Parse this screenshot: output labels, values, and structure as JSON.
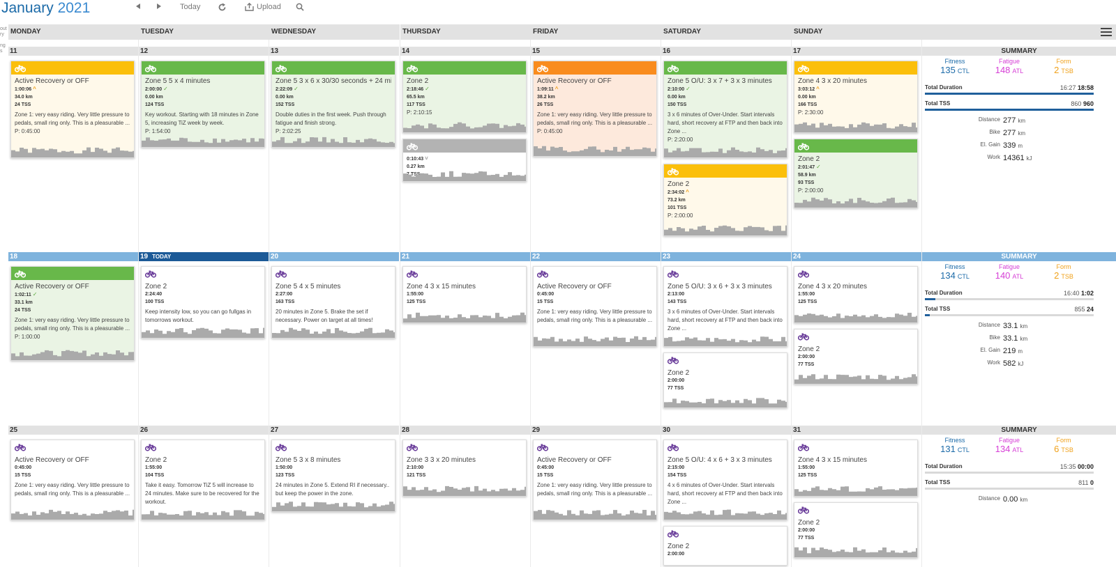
{
  "header": {
    "month": "January",
    "year": "2021",
    "today_label": "Today",
    "upload_label": "Upload",
    "left_sliver": "out\nry\n\nng\ns"
  },
  "day_names": [
    "MONDAY",
    "TUESDAY",
    "WEDNESDAY",
    "THURSDAY",
    "FRIDAY",
    "SATURDAY",
    "SUNDAY"
  ],
  "colors": {
    "title_blue": "#1b6aa8",
    "today_blue": "#1c5a97",
    "week_blue": "#7eb3dd",
    "yellow": "#fbbf0b",
    "green": "#68b84a",
    "orange": "#f98c1e",
    "fitness": "#1b6aa8",
    "fatigue": "#d63fd6",
    "form": "#f0a11a"
  },
  "weeks": [
    {
      "days": [
        "11",
        "12",
        "13",
        "14",
        "15",
        "16",
        "17"
      ],
      "today_index": -1,
      "today_label": "",
      "bar_style": "grey",
      "workouts": [
        [
          {
            "bar": "yellow",
            "bg": "c-yellow",
            "icon": "bike-icon",
            "title": "Active Recovery or OFF",
            "stats": [
              "1:00:06",
              "34.0 km",
              "24 TSS"
            ],
            "check": "o",
            "desc": "Zone 1: very easy riding. Very little pressure to pedals, small ring only. This is a pleasurable ...",
            "plan": "P: 0:45:00",
            "h": 140
          }
        ],
        [
          {
            "bar": "green",
            "bg": "c-green",
            "icon": "bike-icon",
            "title": "Zone 5 5 x 4 minutes",
            "stats": [
              "2:00:00",
              "0.00 km",
              "124 TSS"
            ],
            "check": "g",
            "desc": "Key workout. Starting with 18 minutes in Zone 5, increasing TiZ week by week.",
            "plan": "P: 1:54:00",
            "h": 125
          }
        ],
        [
          {
            "bar": "green",
            "bg": "c-green",
            "icon": "bike-icon",
            "title": "Zone 5 3 x 6 x 30/30 seconds + 24 mi...",
            "stats": [
              "2:22:09",
              "0.00 km",
              "152 TSS"
            ],
            "check": "g",
            "desc": "Double duties in the first week. Push through fatigue and finish strong.",
            "plan": "P: 2:02:25",
            "h": 125
          }
        ],
        [
          {
            "bar": "green",
            "bg": "c-green",
            "icon": "bike-icon",
            "title": "Zone 2",
            "stats": [
              "2:18:46",
              "65.5 km",
              "117 TSS"
            ],
            "check": "g",
            "desc": "",
            "plan": "P: 2:10:15",
            "h": 104
          },
          {
            "bar": "grey",
            "bg": "",
            "icon": "bike-icon",
            "title": "",
            "stats": [
              "0:10:43",
              "0.27 km",
              "7 TSS"
            ],
            "check": "gr",
            "desc": "",
            "plan": "",
            "h": 62
          }
        ],
        [
          {
            "bar": "orange",
            "bg": "c-orange",
            "icon": "bike-icon",
            "title": "Active Recovery or OFF",
            "stats": [
              "1:09:11",
              "38.2 km",
              "26 TSS"
            ],
            "check": "o",
            "desc": "Zone 1: very easy riding. Very little pressure to pedals, small ring only. This is a pleasurable ...",
            "plan": "P: 0:45:00",
            "h": 138
          }
        ],
        [
          {
            "bar": "green",
            "bg": "c-green",
            "icon": "bike-icon",
            "title": "Zone 5 O/U: 3 x 7 + 3 x 3 minutes",
            "stats": [
              "2:10:00",
              "0.00 km",
              "150 TSS"
            ],
            "check": "g",
            "desc": "3 x 6 minutes of Over-Under. Start intervals hard, short recovery at FTP and then back into Zone ...",
            "plan": "P: 2:20:00",
            "h": 140
          },
          {
            "bar": "yellow",
            "bg": "c-yellow",
            "icon": "bike-icon",
            "title": "Zone 2",
            "stats": [
              "2:34:02",
              "73.2 km",
              "101 TSS"
            ],
            "check": "o",
            "desc": "",
            "plan": "P: 2:00:00",
            "h": 104
          }
        ],
        [
          {
            "bar": "yellow",
            "bg": "c-yellow",
            "icon": "bike-icon",
            "title": "Zone 4 3 x 20 minutes",
            "stats": [
              "3:03:12",
              "0.00 km",
              "166 TSS"
            ],
            "check": "o",
            "desc": "",
            "plan": "P: 2:30:00",
            "h": 104
          },
          {
            "bar": "green",
            "bg": "c-green",
            "icon": "bike-icon",
            "title": "Zone 2",
            "stats": [
              "2:01:47",
              "58.9 km",
              "93 TSS"
            ],
            "check": "g",
            "desc": "",
            "plan": "P: 2:00:00",
            "h": 100
          }
        ]
      ],
      "summary": {
        "label": "SUMMARY",
        "fitness_label": "Fitness",
        "fitness": "135",
        "fitness_unit": "CTL",
        "fatigue_label": "Fatigue",
        "fatigue": "148",
        "fatigue_unit": "ATL",
        "form_label": "Form",
        "form": "2",
        "form_unit": "TSB",
        "duration_label": "Total Duration",
        "duration_planned": "16:27",
        "duration_done": "18:58",
        "duration_fill": 1.0,
        "tss_label": "Total TSS",
        "tss_planned": "860",
        "tss_done": "960",
        "tss_fill": 1.0,
        "stats": [
          {
            "k": "Distance",
            "v": "277",
            "u": "km"
          },
          {
            "k": "Bike",
            "v": "277",
            "u": "km"
          },
          {
            "k": "El. Gain",
            "v": "339",
            "u": "m"
          },
          {
            "k": "Work",
            "v": "14361",
            "u": "kJ"
          }
        ]
      }
    },
    {
      "days": [
        "18",
        "19",
        "20",
        "21",
        "22",
        "23",
        "24"
      ],
      "today_index": 1,
      "today_label": "TODAY",
      "bar_style": "blue",
      "workouts": [
        [
          {
            "bar": "green",
            "bg": "c-green",
            "icon": "bike-icon",
            "title": "Active Recovery or OFF",
            "stats": [
              "1:02:11",
              "33.1 km",
              "24 TSS"
            ],
            "check": "g",
            "desc": "Zone 1: very easy riding. Very little pressure to pedals, small ring only. This is a pleasurable ...",
            "plan": "P: 1:00:00",
            "h": 136
          }
        ],
        [
          {
            "bar": "none",
            "bg": "",
            "icon": "bike-purple-icon",
            "title": "Zone 2",
            "stats": [
              "2:24:40",
              "100 TSS"
            ],
            "check": "",
            "desc": "Keep intensity low, so you can go fullgas in tomorrows workout.",
            "plan": "",
            "h": 104
          }
        ],
        [
          {
            "bar": "none",
            "bg": "",
            "icon": "bike-purple-icon",
            "title": "Zone 5 4 x 5 minutes",
            "stats": [
              "2:27:00",
              "163 TSS"
            ],
            "check": "",
            "desc": "20 minutes in Zone 5. Brake the set if necessary. Power on target at all times!",
            "plan": "",
            "h": 104
          }
        ],
        [
          {
            "bar": "none",
            "bg": "",
            "icon": "bike-purple-icon",
            "title": "Zone 4 3 x 15 minutes",
            "stats": [
              "1:55:00",
              "125 TSS"
            ],
            "check": "",
            "desc": "",
            "plan": "",
            "h": 82
          }
        ],
        [
          {
            "bar": "none",
            "bg": "",
            "icon": "bike-purple-icon",
            "title": "Active Recovery or OFF",
            "stats": [
              "0:45:00",
              "15 TSS"
            ],
            "check": "",
            "desc": "Zone 1: very easy riding. Very little pressure to pedals, small ring only. This is a pleasurable ...",
            "plan": "",
            "h": 116
          }
        ],
        [
          {
            "bar": "none",
            "bg": "",
            "icon": "bike-purple-icon",
            "title": "Zone 5 O/U: 3 x 6 + 3 x 3 minutes",
            "stats": [
              "2:13:00",
              "143 TSS"
            ],
            "check": "",
            "desc": "3 x 6 minutes of Over-Under. Start intervals hard, short recovery at FTP and then back into Zone ...",
            "plan": "",
            "h": 116
          },
          {
            "bar": "none",
            "bg": "",
            "icon": "bike-purple-icon",
            "title": "Zone 2",
            "stats": [
              "2:00:00",
              "77 TSS"
            ],
            "check": "",
            "desc": "",
            "plan": "",
            "h": 80
          }
        ],
        [
          {
            "bar": "none",
            "bg": "",
            "icon": "bike-purple-icon",
            "title": "Zone 4 3 x 20 minutes",
            "stats": [
              "1:55:00",
              "125 TSS"
            ],
            "check": "",
            "desc": "",
            "plan": "",
            "h": 82
          },
          {
            "bar": "none",
            "bg": "",
            "icon": "bike-purple-icon",
            "title": "Zone 2",
            "stats": [
              "2:00:00",
              "77 TSS"
            ],
            "check": "",
            "desc": "",
            "plan": "",
            "h": 80
          }
        ]
      ],
      "summary": {
        "label": "SUMMARY",
        "fitness_label": "Fitness",
        "fitness": "134",
        "fitness_unit": "CTL",
        "fatigue_label": "Fatigue",
        "fatigue": "140",
        "fatigue_unit": "ATL",
        "form_label": "Form",
        "form": "2",
        "form_unit": "TSB",
        "duration_label": "Total Duration",
        "duration_planned": "16:40",
        "duration_done": "1:02",
        "duration_fill": 0.06,
        "tss_label": "Total TSS",
        "tss_planned": "855",
        "tss_done": "24",
        "tss_fill": 0.03,
        "stats": [
          {
            "k": "Distance",
            "v": "33.1",
            "u": "km"
          },
          {
            "k": "Bike",
            "v": "33.1",
            "u": "km"
          },
          {
            "k": "El. Gain",
            "v": "219",
            "u": "m"
          },
          {
            "k": "Work",
            "v": "582",
            "u": "kJ"
          }
        ]
      }
    },
    {
      "days": [
        "25",
        "26",
        "27",
        "28",
        "29",
        "30",
        "31"
      ],
      "today_index": -1,
      "today_label": "",
      "bar_style": "grey",
      "workouts": [
        [
          {
            "bar": "none",
            "bg": "",
            "icon": "bike-purple-icon",
            "title": "Active Recovery or OFF",
            "stats": [
              "0:45:00",
              "15 TSS"
            ],
            "check": "",
            "desc": "Zone 1: very easy riding. Very little pressure to pedals, small ring only. This is a pleasurable ...",
            "plan": "",
            "h": 116
          }
        ],
        [
          {
            "bar": "none",
            "bg": "",
            "icon": "bike-purple-icon",
            "title": "Zone 2",
            "stats": [
              "1:55:00",
              "104 TSS"
            ],
            "check": "",
            "desc": "Take it easy. Tomorrow TiZ 5 will increase to 24 minutes. Make sure to be recovered for the workout.",
            "plan": "",
            "h": 116
          }
        ],
        [
          {
            "bar": "none",
            "bg": "",
            "icon": "bike-purple-icon",
            "title": "Zone 5 3 x 8 minutes",
            "stats": [
              "1:50:00",
              "123 TSS"
            ],
            "check": "",
            "desc": "24 minutes in Zone 5. Extend RI if necessary.. but keep the power in the zone.",
            "plan": "",
            "h": 104
          }
        ],
        [
          {
            "bar": "none",
            "bg": "",
            "icon": "bike-purple-icon",
            "title": "Zone 3 3 x 20 minutes",
            "stats": [
              "2:10:00",
              "121 TSS"
            ],
            "check": "",
            "desc": "",
            "plan": "",
            "h": 82
          }
        ],
        [
          {
            "bar": "none",
            "bg": "",
            "icon": "bike-purple-icon",
            "title": "Active Recovery or OFF",
            "stats": [
              "0:45:00",
              "15 TSS"
            ],
            "check": "",
            "desc": "Zone 1: very easy riding. Very little pressure to pedals, small ring only. This is a pleasurable ...",
            "plan": "",
            "h": 116
          }
        ],
        [
          {
            "bar": "none",
            "bg": "",
            "icon": "bike-purple-icon",
            "title": "Zone 5 O/U: 4 x 6 + 3 x 3 minutes",
            "stats": [
              "2:15:00",
              "154 TSS"
            ],
            "check": "",
            "desc": "4 x 6 minutes of Over-Under. Start intervals hard, short recovery at FTP and then back into Zone ...",
            "plan": "",
            "h": 116
          },
          {
            "bar": "none",
            "bg": "",
            "icon": "bike-purple-icon",
            "title": "Zone 2",
            "stats": [
              "2:00:00"
            ],
            "check": "",
            "desc": "",
            "plan": "",
            "h": 80
          }
        ],
        [
          {
            "bar": "none",
            "bg": "",
            "icon": "bike-purple-icon",
            "title": "Zone 4 3 x 15 minutes",
            "stats": [
              "1:55:00",
              "125 TSS"
            ],
            "check": "",
            "desc": "",
            "plan": "",
            "h": 82
          },
          {
            "bar": "none",
            "bg": "",
            "icon": "bike-purple-icon",
            "title": "Zone 2",
            "stats": [
              "2:00:00",
              "77 TSS"
            ],
            "check": "",
            "desc": "",
            "plan": "",
            "h": 80
          }
        ]
      ],
      "summary": {
        "label": "SUMMARY",
        "fitness_label": "Fitness",
        "fitness": "131",
        "fitness_unit": "CTL",
        "fatigue_label": "Fatigue",
        "fatigue": "134",
        "fatigue_unit": "ATL",
        "form_label": "Form",
        "form": "6",
        "form_unit": "TSB",
        "duration_label": "Total Duration",
        "duration_planned": "15:35",
        "duration_done": "00:00",
        "duration_fill": 0,
        "tss_label": "Total TSS",
        "tss_planned": "811",
        "tss_done": "0",
        "tss_fill": 0,
        "stats": [
          {
            "k": "Distance",
            "v": "0.00",
            "u": "km"
          }
        ]
      }
    }
  ]
}
